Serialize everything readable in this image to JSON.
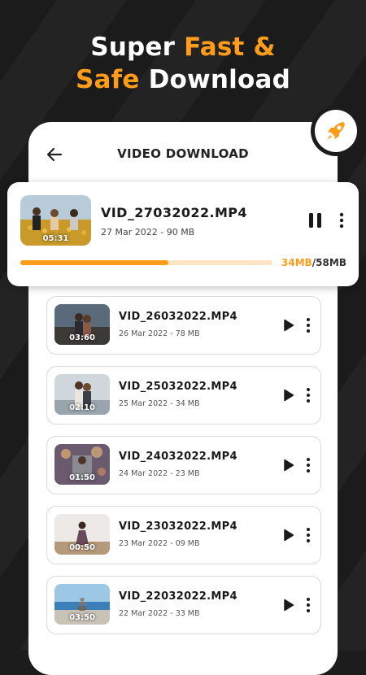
{
  "headline": {
    "line1_plain": "Super ",
    "line1_accent": "Fast &",
    "line2_accent": "Safe",
    "line2_plain": " Download"
  },
  "colors": {
    "accent": "#ff9c1a",
    "background": "#1b1b1b"
  },
  "screen": {
    "title": "VIDEO DOWNLOAD",
    "back_icon": "arrow-left-icon",
    "badge_icon": "rocket-icon"
  },
  "active_download": {
    "name": "VID_27032022.MP4",
    "meta": "27 Mar 2022 - 90 MB",
    "duration": "05:31",
    "downloaded": "34MB",
    "total": "/58MB",
    "progress_fraction": 0.586,
    "action_icon": "pause-icon"
  },
  "videos": [
    {
      "name": "VID_26032022.MP4",
      "meta": "26 Mar 2022 - 78 MB",
      "duration": "03:60"
    },
    {
      "name": "VID_25032022.MP4",
      "meta": "25 Mar 2022 - 34 MB",
      "duration": "02:10"
    },
    {
      "name": "VID_24032022.MP4",
      "meta": "24 Mar 2022 - 23 MB",
      "duration": "01:50"
    },
    {
      "name": "VID_23032022.MP4",
      "meta": "23 Mar 2022 - 09 MB",
      "duration": "00:50"
    },
    {
      "name": "VID_22032022.MP4",
      "meta": "22 Mar 2022 - 33 MB",
      "duration": "03:50"
    }
  ]
}
